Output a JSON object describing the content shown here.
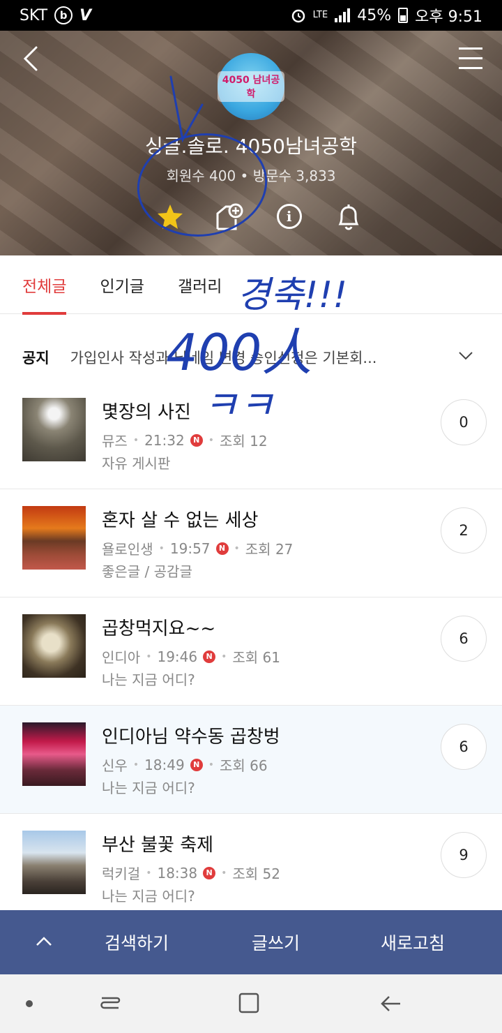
{
  "status_bar": {
    "carrier": "SKT",
    "network": "LTE",
    "battery": "45%",
    "time": "오후 9:51"
  },
  "cafe": {
    "logo_text": "4050 남녀공학",
    "title": "싱글.솔로. 4050남녀공학",
    "stats": "회원수 400 • 방문수 3,833"
  },
  "header_icons": [
    "star-icon",
    "chat-add-icon",
    "info-icon",
    "bell-icon"
  ],
  "tabs": [
    {
      "label": "전체글",
      "active": true
    },
    {
      "label": "인기글",
      "active": false
    },
    {
      "label": "갤러리",
      "active": false
    }
  ],
  "notice": {
    "tag": "공지",
    "text": "가입인사 작성과 닉네임 변경 승인신청은 기본회..."
  },
  "posts": [
    {
      "title": "몇장의 사진",
      "author": "뮤즈",
      "time": "21:32",
      "new": "N",
      "views": "조회 12",
      "board": "자유 게시판",
      "comments": "0"
    },
    {
      "title": "혼자 살 수 없는 세상",
      "author": "욜로인생",
      "time": "19:57",
      "new": "N",
      "views": "조회 27",
      "board": "좋은글 / 공감글",
      "comments": "2"
    },
    {
      "title": "곱창먹지요~~",
      "author": "인디아",
      "time": "19:46",
      "new": "N",
      "views": "조회 61",
      "board": "나는 지금 어디?",
      "comments": "6"
    },
    {
      "title": "인디아님 약수동 곱창벙",
      "author": "신우",
      "time": "18:49",
      "new": "N",
      "views": "조회 66",
      "board": "나는 지금 어디?",
      "comments": "6"
    },
    {
      "title": "부산 불꽃 축제",
      "author": "럭키걸",
      "time": "18:38",
      "new": "N",
      "views": "조회 52",
      "board": "나는 지금 어디?",
      "comments": "9"
    }
  ],
  "bottom_bar": {
    "search": "검색하기",
    "write": "글쓰기",
    "refresh": "새로고침"
  },
  "handwriting": {
    "line1": "경축!!!",
    "line2": "400人",
    "line3": "ㅋㅋ"
  },
  "colors": {
    "accent": "#e03c3c",
    "bottom_bar": "#45598f",
    "ink": "#1f3fb0"
  }
}
